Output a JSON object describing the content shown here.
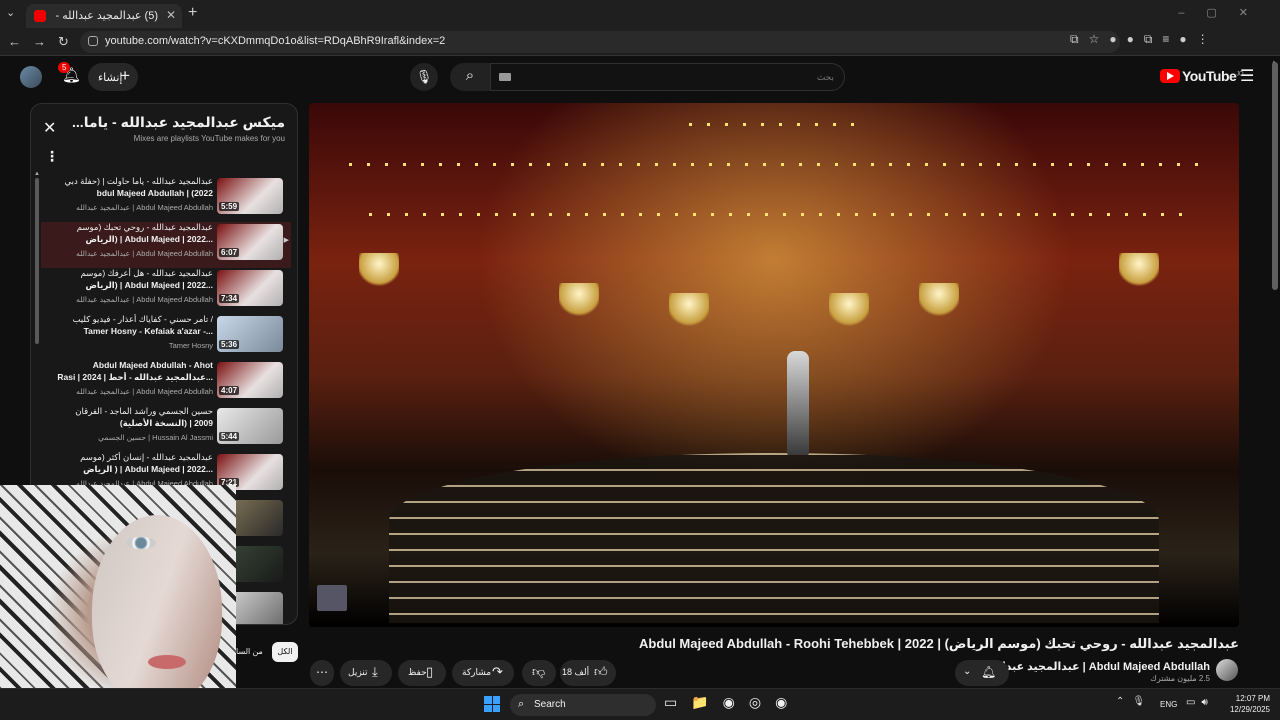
{
  "browser": {
    "tab_title": "(5) عبدالمجيد عبدالله - روحي",
    "tab_close": "✕",
    "new_tab": "+",
    "url": "youtube.com/watch?v=cKXDmmqDo1o&list=RDqABhR9Irafl&index=2"
  },
  "youtube": {
    "logo_text": "YouTube",
    "logo_region": "JO",
    "notifications_count": "5",
    "create_label": "إنشاء",
    "search_placeholder": "بحث"
  },
  "playlist": {
    "title": "ميكس عبدالمجيد عبدالله - ياما...",
    "subtitle": "Mixes are playlists YouTube makes for you",
    "items": [
      {
        "line1": "عبدالمجيد عبدالله - ياما حاولت | (حفلة دبي",
        "line2": "bdul Majeed Abdullah | (2022",
        "channel": "عبدالمجيد عبدالله | Abdul Majeed Abdullah",
        "duration": "5:59"
      },
      {
        "line1": "عبدالمجيد عبدالله - روحي تحبك (موسم",
        "line2": "الرياض) | Abdul Majeed | 2022...",
        "channel": "عبدالمجيد عبدالله | Abdul Majeed Abdullah",
        "duration": "6:07"
      },
      {
        "line1": "عبدالمجيد عبدالله - هل أعرفك (موسم",
        "line2": "الرياض) | Abdul Majeed | 2022...",
        "channel": "عبدالمجيد عبدالله | Abdul Majeed Abdullah",
        "duration": "7:34"
      },
      {
        "line1": "تامر حسني - كفاياك أعذار - فيديو كليب /",
        "line2": "Tamer Hosny - Kefaiak a'azar -...",
        "channel": "Tamer Hosny",
        "duration": "5:36"
      },
      {
        "line1": "Abdul Majeed Abdullah - Ahot",
        "line2": "Rasi | 2024 | عبدالمجيد عبدالله - أحط...",
        "channel": "عبدالمجيد عبدالله | Abdul Majeed Abdullah",
        "duration": "4:07"
      },
      {
        "line1": "حسين الجسمي وراشد الماجد - الفرقان",
        "line2": "(النسخة الأصلية) | 2009",
        "channel": "حسين الجسمي | Hussain Al Jassmi",
        "duration": "5:44"
      },
      {
        "line1": "عبدالمجيد عبدالله - إنسان أكثر (موسم",
        "line2": "الرياض ) | Abdul Majeed | 2022...",
        "channel": "عبدالمجيد عبدالله | Abdul Majeed Abdullah",
        "duration": "7:21"
      }
    ]
  },
  "video": {
    "title": "عبدالمجيد عبدالله - روحي تحبك (موسم الرياض) | Abdul Majeed Abdullah - Roohi Tehebbek | 2022",
    "channel": "عبدالمجيد عبدالله | Abdul Majeed Abdullah",
    "subscribers": "2.5 مليون مشترك",
    "likes": "18 ألف",
    "share_label": "مشاركة",
    "save_label": "حفظ",
    "download_label": "تنزيل",
    "chip_all": "الكل",
    "chip_from": "من السا"
  },
  "taskbar": {
    "search_label": "Search",
    "lang": "ENG",
    "time": "12:07 PM",
    "date": "12/29/2025"
  },
  "colors": {
    "accent": "#ff0000",
    "background": "#0f0f0f"
  }
}
